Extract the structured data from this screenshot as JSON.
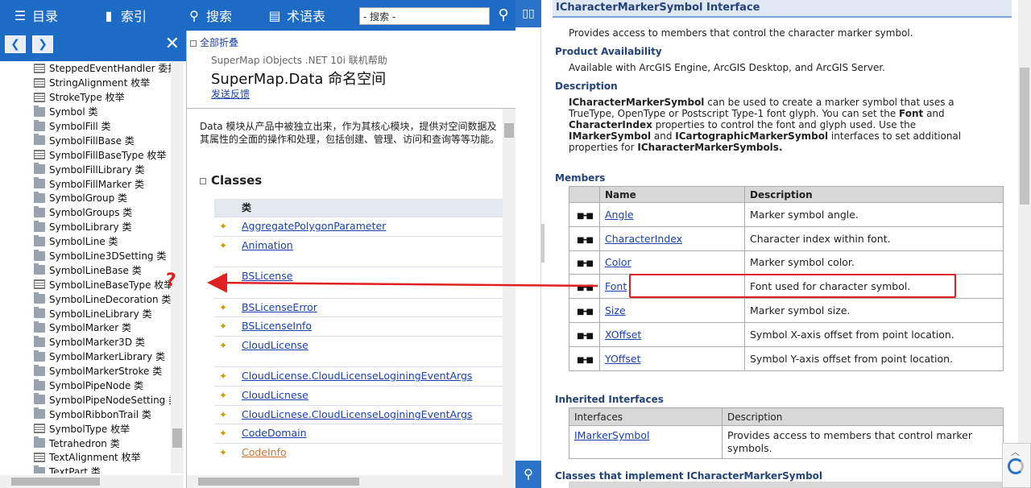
{
  "toolbar": {
    "contents": "目录",
    "index": "索引",
    "search": "搜索",
    "glossary": "术语表",
    "search_value": "- 搜索 -"
  },
  "tree": {
    "items": [
      {
        "label": "SteppedEventHandler 委托",
        "icon": "doc"
      },
      {
        "label": "StringAlignment 枚举",
        "icon": "doc"
      },
      {
        "label": "StrokeType 枚举",
        "icon": "doc"
      },
      {
        "label": "Symbol 类",
        "icon": "folder"
      },
      {
        "label": "SymbolFill 类",
        "icon": "folder"
      },
      {
        "label": "SymbolFillBase 类",
        "icon": "folder"
      },
      {
        "label": "SymbolFillBaseType 枚举",
        "icon": "doc"
      },
      {
        "label": "SymbolFillLibrary 类",
        "icon": "folder"
      },
      {
        "label": "SymbolFillMarker 类",
        "icon": "folder"
      },
      {
        "label": "SymbolGroup 类",
        "icon": "folder"
      },
      {
        "label": "SymbolGroups 类",
        "icon": "folder"
      },
      {
        "label": "SymbolLibrary 类",
        "icon": "folder"
      },
      {
        "label": "SymbolLine 类",
        "icon": "folder"
      },
      {
        "label": "SymbolLine3DSetting 类",
        "icon": "folder"
      },
      {
        "label": "SymbolLineBase 类",
        "icon": "folder"
      },
      {
        "label": "SymbolLineBaseType 枚举",
        "icon": "doc"
      },
      {
        "label": "SymbolLineDecoration 类",
        "icon": "folder"
      },
      {
        "label": "SymbolLineLibrary 类",
        "icon": "folder"
      },
      {
        "label": "SymbolMarker 类",
        "icon": "folder"
      },
      {
        "label": "SymbolMarker3D 类",
        "icon": "folder"
      },
      {
        "label": "SymbolMarkerLibrary 类",
        "icon": "folder"
      },
      {
        "label": "SymbolMarkerStroke 类",
        "icon": "folder"
      },
      {
        "label": "SymbolPipeNode 类",
        "icon": "folder"
      },
      {
        "label": "SymbolPipeNodeSetting 类",
        "icon": "folder"
      },
      {
        "label": "SymbolRibbonTrail 类",
        "icon": "folder"
      },
      {
        "label": "SymbolType 枚举",
        "icon": "doc"
      },
      {
        "label": "Tetrahedron 类",
        "icon": "folder"
      },
      {
        "label": "TextAlignment 枚举",
        "icon": "doc"
      },
      {
        "label": "TextPart 类",
        "icon": "folder"
      }
    ]
  },
  "annotation": {
    "question": "?"
  },
  "content": {
    "collapse_all": "全部折叠",
    "subtitle": "SuperMap iObjects .NET 10i 联机帮助",
    "title": "SuperMap.Data 命名空间",
    "feedback": "发送反馈",
    "intro": "Data 模块从产品中被独立出来，作为其核心模块，提供对空间数据及其属性的全面的操作和处理，包括创建、管理、访问和查询等等功能。",
    "classes_heading": "Classes",
    "table_header": "类",
    "classes": [
      {
        "name": "AggregatePolygonParameter",
        "top": 0
      },
      {
        "name": "Animation",
        "top": 0
      },
      {
        "name": "BSLicense",
        "top": 0
      },
      {
        "name": "BSLicenseError",
        "top": 0
      },
      {
        "name": "BSLicenseInfo",
        "top": 0
      },
      {
        "name": "CloudLicense",
        "top": 0
      },
      {
        "name": "CloudLicense.CloudLicenseLoginingEventArgs",
        "top": 0
      },
      {
        "name": "CloudLicnese",
        "top": 0
      },
      {
        "name": "CloudLicnese.CloudLicenseLoginingEventArgs",
        "top": 0
      },
      {
        "name": "CodeDomain",
        "top": 0
      },
      {
        "name": "CodeInfo",
        "top": 0
      }
    ]
  },
  "right": {
    "title": "ICharacterMarkerSymbol Interface",
    "summary": "Provides access to members that control the character marker symbol.",
    "availability_heading": "Product Availability",
    "availability": "Available with ArcGIS Engine, ArcGIS Desktop, and ArcGIS Server.",
    "description_heading": "Description",
    "desc_1_bold": "ICharacterMarkerSymbol",
    "desc_1": " can be used to create a marker symbol that uses a TrueType, OpenType or Postscript Type-1 font glyph. You can set the ",
    "desc_font": "Font",
    "desc_and": " and ",
    "desc_charindex": "CharacterIndex",
    "desc_2": " properties to control the font and glyph used. Use the ",
    "desc_imarker": "IMarkerSymbol",
    "desc_3": " and ",
    "desc_icarto": "ICartographicMarkerSymbol",
    "desc_4": " interfaces to set additional properties for ",
    "desc_ichar2": "ICharacterMarkerSymbols.",
    "members_heading": "Members",
    "members_header": {
      "name": "Name",
      "description": "Description"
    },
    "members": [
      {
        "name": "Angle",
        "description": "Marker symbol angle."
      },
      {
        "name": "CharacterIndex",
        "description": "Character index within font."
      },
      {
        "name": "Color",
        "description": "Marker symbol color."
      },
      {
        "name": "Font",
        "description": "Font used for character symbol."
      },
      {
        "name": "Size",
        "description": "Marker symbol size."
      },
      {
        "name": "XOffset",
        "description": "Symbol X-axis offset from point location."
      },
      {
        "name": "YOffset",
        "description": "Symbol Y-axis offset from point location."
      }
    ],
    "inherited_heading": "Inherited Interfaces",
    "inherited_header": {
      "interfaces": "Interfaces",
      "description": "Description"
    },
    "inherited": [
      {
        "name": "IMarkerSymbol",
        "description": "Provides access to members that control marker symbols."
      }
    ],
    "implement_heading": "Classes that implement ICharacterMarkerSymbol"
  },
  "colors": {
    "accent": "#1d6bc5",
    "highlight": "#e02020",
    "link": "#1a3fb0"
  }
}
